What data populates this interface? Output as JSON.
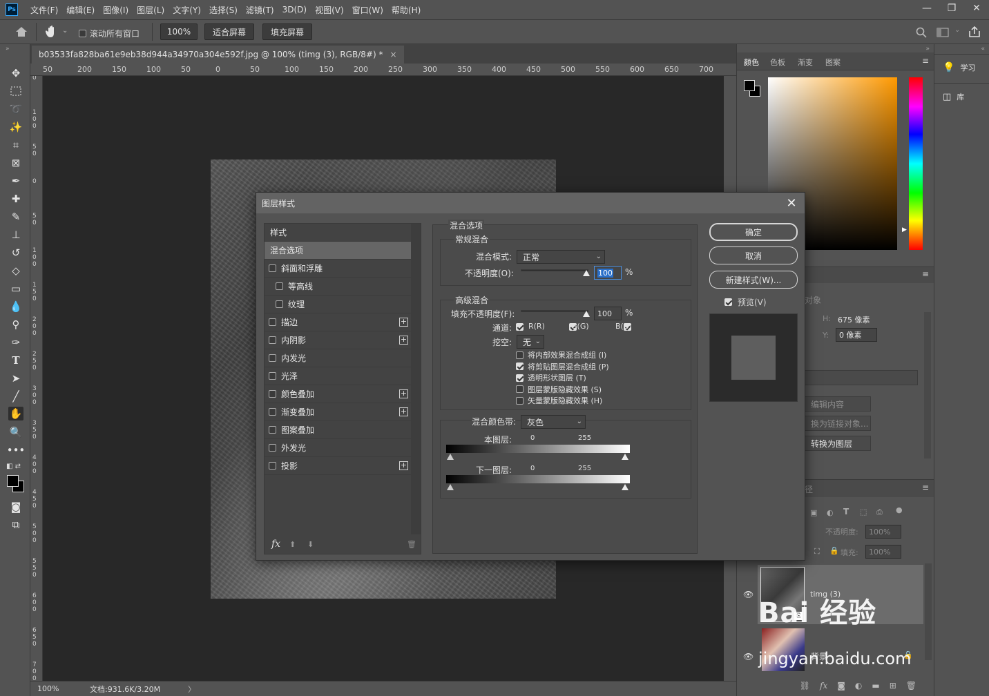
{
  "app": {
    "logo": "Ps"
  },
  "menu": [
    "文件(F)",
    "编辑(E)",
    "图像(I)",
    "图层(L)",
    "文字(Y)",
    "选择(S)",
    "滤镜(T)",
    "3D(D)",
    "视图(V)",
    "窗口(W)",
    "帮助(H)"
  ],
  "window_controls": {
    "minimize": "—",
    "restore": "❐",
    "close": "✕"
  },
  "options": {
    "scroll_all_label": "滚动所有窗口",
    "zoom_value": "100%",
    "fit_screen": "适合屏幕",
    "fill_screen": "填充屏幕"
  },
  "document": {
    "tab_title": "b03533fa828ba61e9eb38d944a34970a304e592f.jpg @ 100% (timg (3), RGB/8#) *",
    "tab_close": "×",
    "status_zoom": "100%",
    "status_doc": "文档:931.6K/3.20M",
    "status_arrow": "〉"
  },
  "ruler_top": [
    "50",
    "200",
    "150",
    "100",
    "50",
    "0",
    "50",
    "100",
    "150",
    "200",
    "250",
    "300",
    "350",
    "400",
    "450",
    "500",
    "550",
    "600",
    "650",
    "700"
  ],
  "ruler_left": [
    "0",
    "1 0 0",
    "5 0",
    "0",
    "5 0",
    "1 0 0",
    "1 5 0",
    "2 0 0",
    "2 5 0",
    "3 0 0",
    "3 5 0",
    "4 0 0",
    "4 5 0",
    "5 0 0",
    "5 5 0",
    "6 0 0",
    "6 5 0",
    "7 0 0"
  ],
  "color_panel": {
    "tabs": [
      "颜色",
      "色板",
      "渐变",
      "图案"
    ]
  },
  "right_col2": {
    "learn": "学习",
    "library": "库"
  },
  "properties": {
    "title_partial": "对象",
    "h_label": "H:",
    "h_value": "675 像素",
    "y_label": "Y:",
    "y_value": "0 像素",
    "edit_content": "编辑内容",
    "convert_linked": "换为链接对象...",
    "convert_layer": "转换为图层"
  },
  "layers": {
    "title_partial": "径",
    "opacity_label": "不透明度:",
    "opacity_value": "100%",
    "fill_label": "填充:",
    "fill_value": "100%",
    "layer1_name": "timg (3)",
    "layer2_name": "背景"
  },
  "watermark": {
    "brand": "Bai 经验",
    "url": "jingyan.baidu.com"
  },
  "dialog": {
    "title": "图层样式",
    "close": "✕",
    "styles_header": "样式",
    "blend_options": "混合选项",
    "effects": [
      {
        "label": "斜面和浮雕",
        "indent": false,
        "plus": false
      },
      {
        "label": "等高线",
        "indent": true,
        "plus": false
      },
      {
        "label": "纹理",
        "indent": true,
        "plus": false
      },
      {
        "label": "描边",
        "indent": false,
        "plus": true
      },
      {
        "label": "内阴影",
        "indent": false,
        "plus": true
      },
      {
        "label": "内发光",
        "indent": false,
        "plus": false
      },
      {
        "label": "光泽",
        "indent": false,
        "plus": false
      },
      {
        "label": "颜色叠加",
        "indent": false,
        "plus": true
      },
      {
        "label": "渐变叠加",
        "indent": false,
        "plus": true
      },
      {
        "label": "图案叠加",
        "indent": false,
        "plus": false
      },
      {
        "label": "外发光",
        "indent": false,
        "plus": false
      },
      {
        "label": "投影",
        "indent": false,
        "plus": true
      }
    ],
    "fx_label": "fx",
    "section_title": "混合选项",
    "general_blending": "常规混合",
    "blend_mode_label": "混合模式:",
    "blend_mode_value": "正常",
    "opacity_label": "不透明度(O):",
    "opacity_value": "100",
    "pct": "%",
    "advanced_blending": "高级混合",
    "fill_opacity_label": "填充不透明度(F):",
    "fill_opacity_value": "100",
    "channels_label": "通道:",
    "ch_r": "R(R)",
    "ch_g": "G(G)",
    "ch_b": "B(B)",
    "knockout_label": "挖空:",
    "knockout_value": "无",
    "adv_options": [
      {
        "label": "将内部效果混合成组 (I)",
        "checked": false
      },
      {
        "label": "将剪贴图层混合成组 (P)",
        "checked": true
      },
      {
        "label": "透明形状图层 (T)",
        "checked": true
      },
      {
        "label": "图层蒙版隐藏效果 (S)",
        "checked": false
      },
      {
        "label": "矢量蒙版隐藏效果 (H)",
        "checked": false
      }
    ],
    "blend_if_label": "混合颜色带:",
    "blend_if_value": "灰色",
    "this_layer_label": "本图层:",
    "this_layer_min": "0",
    "this_layer_max": "255",
    "under_layer_label": "下一图层:",
    "under_layer_min": "0",
    "under_layer_max": "255",
    "ok": "确定",
    "cancel": "取消",
    "new_style": "新建样式(W)...",
    "preview_label": "预览(V)"
  }
}
